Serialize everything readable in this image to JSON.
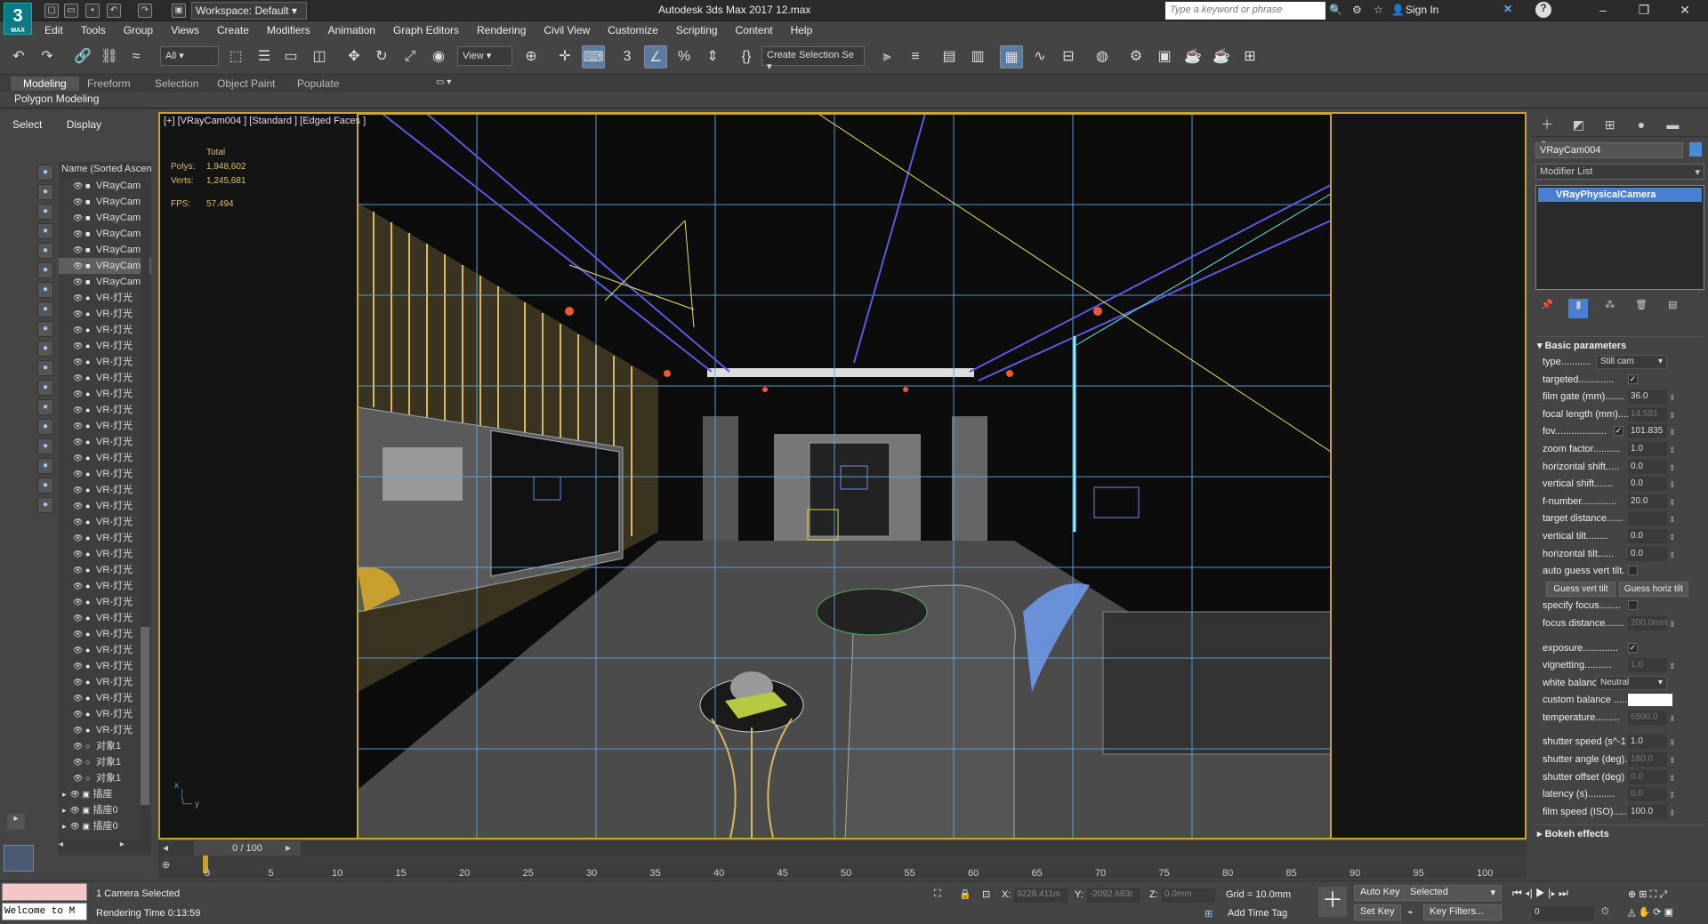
{
  "titlebar": {
    "logo_text": "3",
    "logo_sub": "MAX",
    "workspace_label": "Workspace: Default",
    "app_title": "Autodesk 3ds Max 2017     12.max",
    "search_placeholder": "Type a keyword or phrase",
    "sign_in": "Sign In",
    "help": "?"
  },
  "menubar": [
    "Edit",
    "Tools",
    "Group",
    "Views",
    "Create",
    "Modifiers",
    "Animation",
    "Graph Editors",
    "Rendering",
    "Civil View",
    "Customize",
    "Scripting",
    "Content",
    "Help"
  ],
  "toolbar": {
    "filter_dropdown": "All",
    "view_dropdown": "View",
    "create_selection_set": "Create Selection Se"
  },
  "ribbon": {
    "tabs": [
      "Modeling",
      "Freeform",
      "Selection",
      "Object Paint",
      "Populate"
    ],
    "active": "Modeling",
    "sub_label": "Polygon Modeling"
  },
  "scene_explorer": {
    "tabs": [
      "Select",
      "Display"
    ],
    "header": "Name (Sorted Ascen",
    "rows": [
      {
        "label": "VRayCam",
        "type": "cam"
      },
      {
        "label": "VRayCam",
        "type": "cam"
      },
      {
        "label": "VRayCam",
        "type": "cam"
      },
      {
        "label": "VRayCam",
        "type": "cam"
      },
      {
        "label": "VRayCam",
        "type": "cam"
      },
      {
        "label": "VRayCam",
        "type": "cam",
        "sel": true
      },
      {
        "label": "VRayCam",
        "type": "cam"
      },
      {
        "label": "VR-灯光",
        "type": "light"
      },
      {
        "label": "VR-灯光",
        "type": "light"
      },
      {
        "label": "VR-灯光",
        "type": "light"
      },
      {
        "label": "VR-灯光",
        "type": "light"
      },
      {
        "label": "VR-灯光",
        "type": "light"
      },
      {
        "label": "VR-灯光",
        "type": "light"
      },
      {
        "label": "VR-灯光",
        "type": "light"
      },
      {
        "label": "VR-灯光",
        "type": "light"
      },
      {
        "label": "VR-灯光",
        "type": "light"
      },
      {
        "label": "VR-灯光",
        "type": "light"
      },
      {
        "label": "VR-灯光",
        "type": "light"
      },
      {
        "label": "VR-灯光",
        "type": "light"
      },
      {
        "label": "VR-灯光",
        "type": "light"
      },
      {
        "label": "VR-灯光",
        "type": "light"
      },
      {
        "label": "VR-灯光",
        "type": "light"
      },
      {
        "label": "VR-灯光",
        "type": "light"
      },
      {
        "label": "VR-灯光",
        "type": "light"
      },
      {
        "label": "VR-灯光",
        "type": "light"
      },
      {
        "label": "VR-灯光",
        "type": "light"
      },
      {
        "label": "VR-灯光",
        "type": "light"
      },
      {
        "label": "VR-灯光",
        "type": "light"
      },
      {
        "label": "VR-灯光",
        "type": "light"
      },
      {
        "label": "VR-灯光",
        "type": "light"
      },
      {
        "label": "VR-灯光",
        "type": "light"
      },
      {
        "label": "VR-灯光",
        "type": "light"
      },
      {
        "label": "VR-灯光",
        "type": "light"
      },
      {
        "label": "VR-灯光",
        "type": "light"
      },
      {
        "label": "VR-灯光",
        "type": "light"
      },
      {
        "label": "对象1",
        "type": "obj"
      },
      {
        "label": "对象1",
        "type": "obj"
      },
      {
        "label": "对象1",
        "type": "obj"
      },
      {
        "label": "插座",
        "type": "group",
        "exp": true
      },
      {
        "label": "插座0",
        "type": "group",
        "exp": true
      },
      {
        "label": "插座0",
        "type": "group",
        "exp": true
      }
    ]
  },
  "viewport": {
    "label": "[+] [VRayCam004 ] [Standard ] [Edged Faces ]",
    "stats_title": "Total",
    "polys_label": "Polys:",
    "polys": "1,948,602",
    "verts_label": "Verts:",
    "verts": "1,245,681",
    "fps_label": "FPS:",
    "fps": "57.494",
    "axis_x": "x",
    "axis_y": "y"
  },
  "command_panel": {
    "object_name": "VRayCam004",
    "modifier_list": "Modifier List",
    "stack_item": "VRayPhysicalCamera",
    "rollout_title": "Basic parameters",
    "params": [
      {
        "label": "type...........",
        "kind": "dd",
        "value": "Still cam"
      },
      {
        "label": "targeted.............",
        "kind": "chk",
        "value": "✓"
      },
      {
        "label": "film gate (mm).......",
        "kind": "num",
        "value": "36.0"
      },
      {
        "label": "focal length (mm)....",
        "kind": "num",
        "value": "14.581",
        "dis": true
      },
      {
        "label": "fov...................",
        "kind": "num",
        "value": "101.835",
        "chk": "✓"
      },
      {
        "label": "zoom factor..........",
        "kind": "num",
        "value": "1.0"
      },
      {
        "label": "horizontal shift.....",
        "kind": "num",
        "value": "0.0"
      },
      {
        "label": "vertical shift.......",
        "kind": "num",
        "value": "0.0"
      },
      {
        "label": "f-number.............",
        "kind": "num",
        "value": "20.0"
      },
      {
        "label": "target distance......",
        "kind": "num",
        "value": ""
      },
      {
        "label": "vertical tilt........",
        "kind": "num",
        "value": "0.0"
      },
      {
        "label": "horizontal tilt......",
        "kind": "num",
        "value": "0.0"
      },
      {
        "label": "auto guess vert tilt.",
        "kind": "chk",
        "value": ""
      },
      {
        "label": "",
        "kind": "btns",
        "value": [
          "Guess vert tilt",
          "Guess horiz tilt"
        ]
      },
      {
        "label": "specify focus........",
        "kind": "chk",
        "value": ""
      },
      {
        "label": "focus distance.......",
        "kind": "num",
        "value": "200.0mm",
        "dis": true
      },
      {
        "label": "",
        "kind": "gap",
        "value": ""
      },
      {
        "label": "exposure.............",
        "kind": "chk",
        "value": "✓"
      },
      {
        "label": "vignetting..........",
        "kind": "num",
        "value": "1.0",
        "dis": true
      },
      {
        "label": "white balance",
        "kind": "dd",
        "value": "Neutral"
      },
      {
        "label": "custom balance .....",
        "kind": "swatch",
        "value": ""
      },
      {
        "label": "temperature.........",
        "kind": "num",
        "value": "6500.0",
        "dis": true
      },
      {
        "label": "",
        "kind": "gap",
        "value": ""
      },
      {
        "label": "shutter speed (s^-1",
        "kind": "num",
        "value": "1.0"
      },
      {
        "label": "shutter angle (deg).",
        "kind": "num",
        "value": "180.0",
        "dis": true
      },
      {
        "label": "shutter offset (deg)",
        "kind": "num",
        "value": "0.0",
        "dis": true
      },
      {
        "label": "latency (s)..........",
        "kind": "num",
        "value": "0.0",
        "dis": true
      },
      {
        "label": "film speed (ISO).....",
        "kind": "num",
        "value": "100.0"
      }
    ],
    "next_rollout": "Bokeh effects"
  },
  "timeline": {
    "frame_counter": "0 / 100",
    "ticks": [
      "0",
      "5",
      "10",
      "15",
      "20",
      "25",
      "30",
      "35",
      "40",
      "45",
      "50",
      "55",
      "60",
      "65",
      "70",
      "75",
      "80",
      "85",
      "90",
      "95",
      "100"
    ]
  },
  "statusbar": {
    "maxscript_text": "Welcome to M",
    "selection": "1 Camera Selected",
    "render_time": "Rendering Time  0:13:59",
    "x_label": "X:",
    "x_value": "9228.411m",
    "y_label": "Y:",
    "y_value": "-2092.683r",
    "z_label": "Z:",
    "z_value": "0.0mm",
    "grid": "Grid = 10.0mm",
    "add_time_tag": "Add Time Tag",
    "auto_key": "Auto Key",
    "set_key": "Set Key",
    "key_mode": "Selected",
    "key_filters": "Key Filters...",
    "frame": "0"
  },
  "colors": {
    "accent": "#4b7fd4",
    "viewport_border": "#c8a533",
    "stats": "#d8c060"
  }
}
